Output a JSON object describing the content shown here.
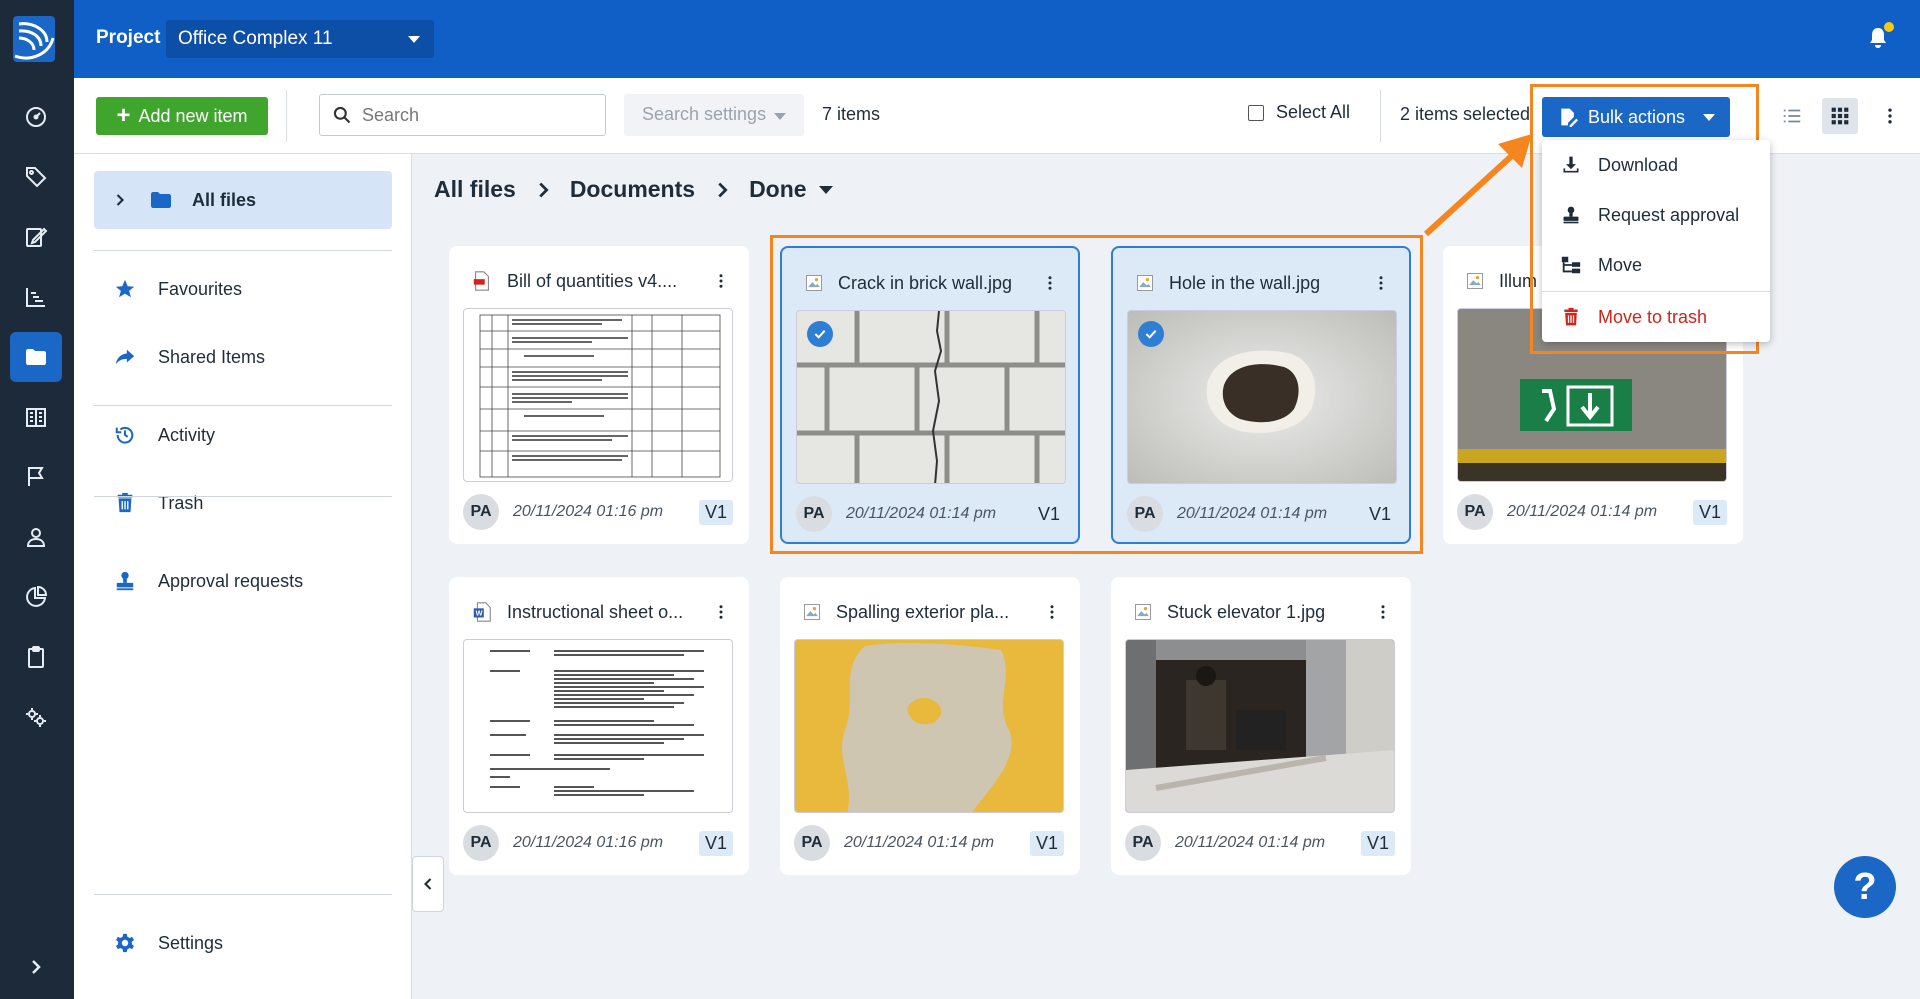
{
  "topbar": {
    "project_label": "Project",
    "project_name": "Office Complex 11"
  },
  "toolbar": {
    "add_label": "Add new item",
    "search_placeholder": "Search",
    "search_settings": "Search settings",
    "items_count": "7 items",
    "select_all": "Select All",
    "items_selected": "2 items selected",
    "bulk_actions": "Bulk actions"
  },
  "sidebar": {
    "items": [
      {
        "label": "All files",
        "icon": "folder-icon"
      },
      {
        "label": "Favourites",
        "icon": "star-icon"
      },
      {
        "label": "Shared Items",
        "icon": "share-icon"
      },
      {
        "label": "Activity",
        "icon": "history-icon"
      },
      {
        "label": "Trash",
        "icon": "trash-icon"
      },
      {
        "label": "Approval requests",
        "icon": "stamp-icon"
      },
      {
        "label": "Settings",
        "icon": "gear-icon"
      }
    ]
  },
  "breadcrumb": [
    "All files",
    "Documents",
    "Done"
  ],
  "files": [
    {
      "name": "Bill of quantities v4....",
      "date": "20/11/2024 01:16 pm",
      "user": "PA",
      "version": "V1",
      "selected": false,
      "type": "pdf"
    },
    {
      "name": "Crack in brick wall.jpg",
      "date": "20/11/2024 01:14 pm",
      "user": "PA",
      "version": "V1",
      "selected": true,
      "type": "image"
    },
    {
      "name": "Hole in the wall.jpg",
      "date": "20/11/2024 01:14 pm",
      "user": "PA",
      "version": "V1",
      "selected": true,
      "type": "image"
    },
    {
      "name": "Illum",
      "date": "20/11/2024 01:14 pm",
      "user": "PA",
      "version": "V1",
      "selected": false,
      "type": "image"
    },
    {
      "name": "Instructional sheet o...",
      "date": "20/11/2024 01:16 pm",
      "user": "PA",
      "version": "V1",
      "selected": false,
      "type": "word"
    },
    {
      "name": "Spalling exterior pla...",
      "date": "20/11/2024 01:14 pm",
      "user": "PA",
      "version": "V1",
      "selected": false,
      "type": "image"
    },
    {
      "name": "Stuck elevator 1.jpg",
      "date": "20/11/2024 01:14 pm",
      "user": "PA",
      "version": "V1",
      "selected": false,
      "type": "image"
    }
  ],
  "bulk_menu": [
    {
      "label": "Download",
      "icon": "download-icon"
    },
    {
      "label": "Request approval",
      "icon": "stamp-icon"
    },
    {
      "label": "Move",
      "icon": "move-icon"
    },
    {
      "label": "Move to trash",
      "icon": "trash-icon"
    }
  ],
  "help_label": "?",
  "colors": {
    "brand_blue": "#0f5fc7",
    "rail": "#1c2a3a",
    "add_green": "#3fa52c",
    "highlight_orange": "#f4851f",
    "danger_red": "#d3231b"
  }
}
